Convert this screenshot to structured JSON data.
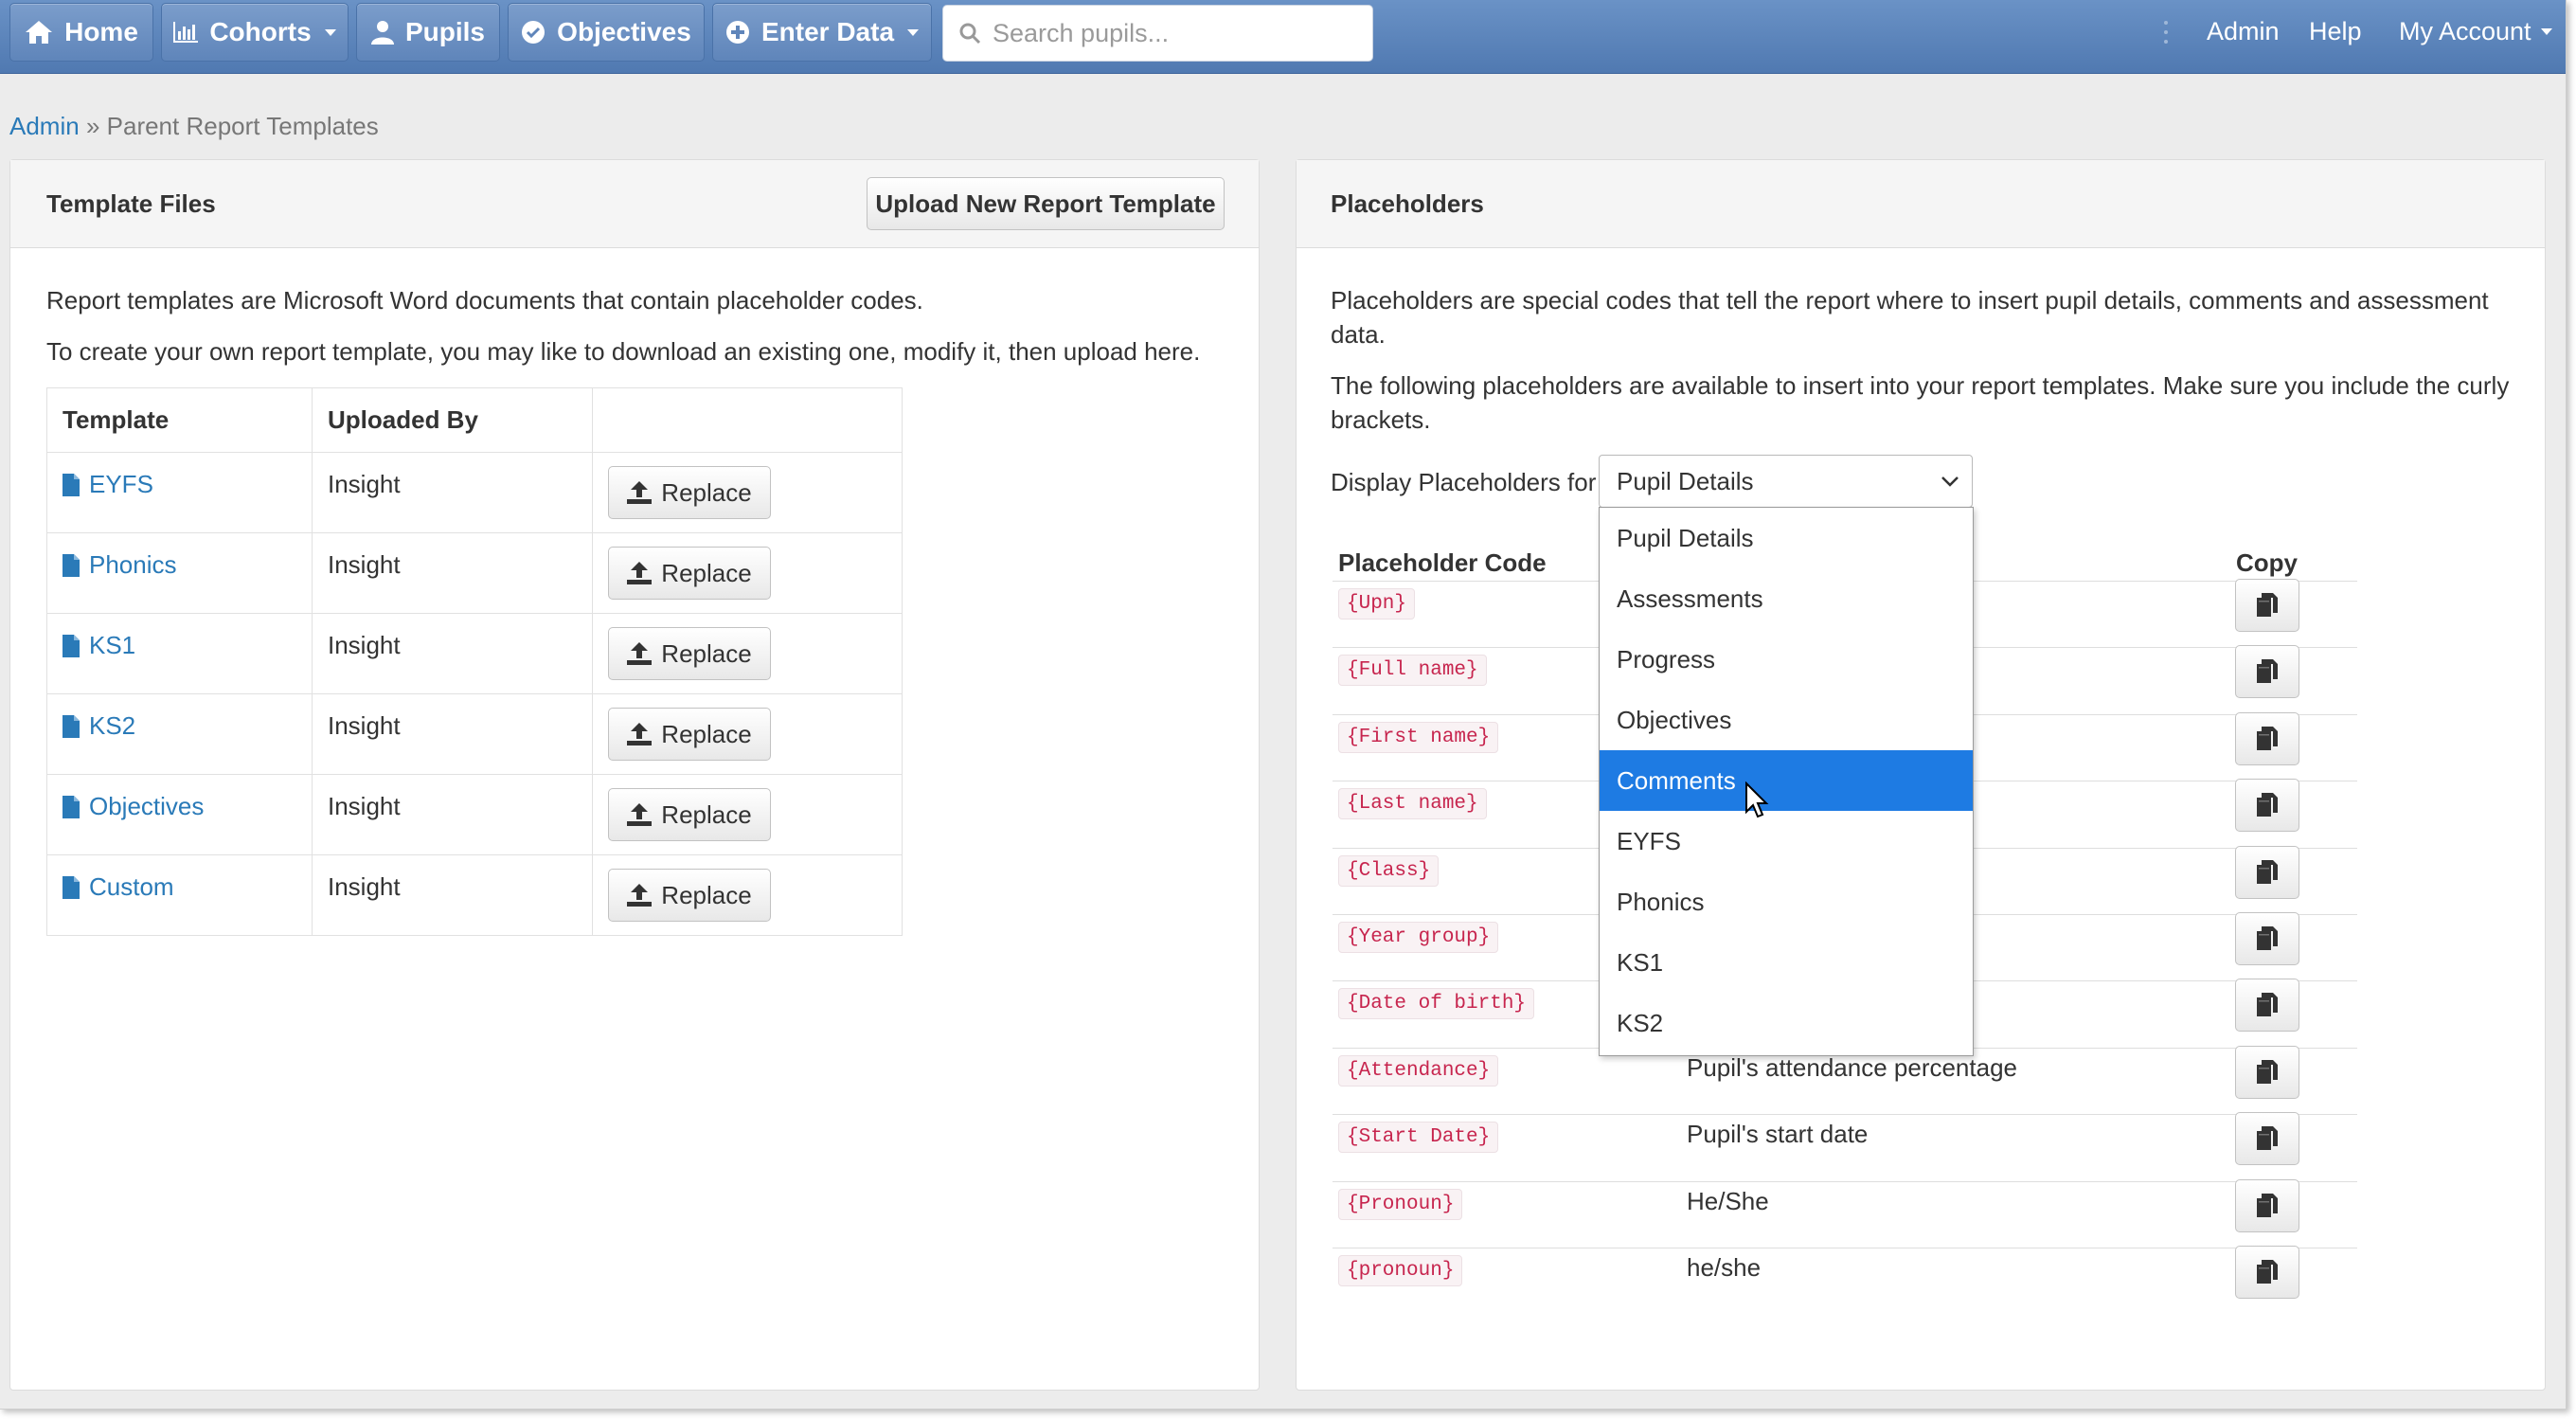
{
  "nav": {
    "home": "Home",
    "cohorts": "Cohorts",
    "pupils": "Pupils",
    "objectives": "Objectives",
    "enter_data": "Enter Data",
    "search_placeholder": "Search pupils...",
    "admin": "Admin",
    "help": "Help",
    "my_account": "My Account"
  },
  "breadcrumb": {
    "root": "Admin",
    "separator": "»",
    "current": "Parent Report Templates"
  },
  "template_panel": {
    "title": "Template Files",
    "upload_button": "Upload New Report Template",
    "intro1": "Report templates are Microsoft Word documents that contain placeholder codes.",
    "intro2": "To create your own report template, you may like to download an existing one, modify it, then upload here.",
    "columns": [
      "Template",
      "Uploaded By",
      ""
    ],
    "rows": [
      {
        "template": "EYFS",
        "uploaded_by": "Insight",
        "action": "Replace"
      },
      {
        "template": "Phonics",
        "uploaded_by": "Insight",
        "action": "Replace"
      },
      {
        "template": "KS1",
        "uploaded_by": "Insight",
        "action": "Replace"
      },
      {
        "template": "KS2",
        "uploaded_by": "Insight",
        "action": "Replace"
      },
      {
        "template": "Objectives",
        "uploaded_by": "Insight",
        "action": "Replace"
      },
      {
        "template": "Custom",
        "uploaded_by": "Insight",
        "action": "Replace"
      }
    ]
  },
  "placeholder_panel": {
    "title": "Placeholders",
    "intro1a": "Placeholders are special codes that tell the report where to insert pupil details, comments and assessment",
    "intro1b": "data.",
    "intro2a": "The following placeholders are available to insert into your report templates. Make sure you include the curly",
    "intro2b": "brackets.",
    "display_label": "Display Placeholders for",
    "selected": "Pupil Details",
    "options": [
      "Pupil Details",
      "Assessments",
      "Progress",
      "Objectives",
      "Comments",
      "EYFS",
      "Phonics",
      "KS1",
      "KS2"
    ],
    "highlighted_option": "Comments",
    "columns": {
      "code": "Placeholder Code",
      "copy": "Copy"
    },
    "rows": [
      {
        "code": "{Upn}",
        "description": ""
      },
      {
        "code": "{Full name}",
        "description": ""
      },
      {
        "code": "{First name}",
        "description": ""
      },
      {
        "code": "{Last name}",
        "description": ""
      },
      {
        "code": "{Class}",
        "description": ""
      },
      {
        "code": "{Year group}",
        "description": ""
      },
      {
        "code": "{Date of birth}",
        "description": ""
      },
      {
        "code": "{Attendance}",
        "description": "Pupil's attendance percentage"
      },
      {
        "code": "{Start Date}",
        "description": "Pupil's start date"
      },
      {
        "code": "{Pronoun}",
        "description": "He/She"
      },
      {
        "code": "{pronoun}",
        "description": "he/she"
      }
    ]
  },
  "colors": {
    "navbar": "#5b83ba",
    "link": "#2a7ab8",
    "code_text": "#c7254e",
    "dropdown_highlight": "#1e7be3"
  }
}
